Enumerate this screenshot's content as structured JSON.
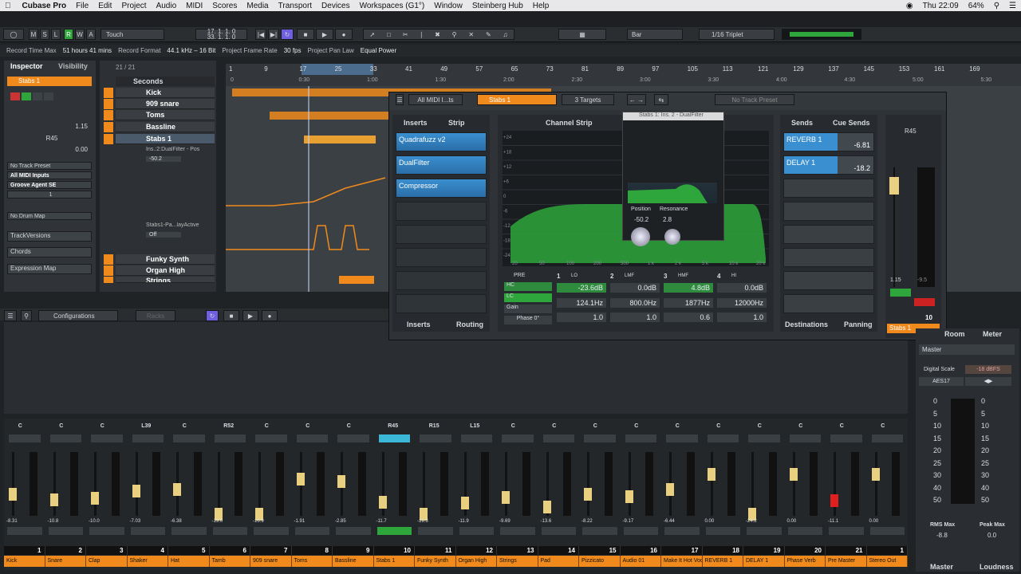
{
  "menubar": {
    "apple": "",
    "app": "Cubase Pro",
    "items": [
      "File",
      "Edit",
      "Project",
      "Audio",
      "MIDI",
      "Scores",
      "Media",
      "Transport",
      "Devices",
      "Workspaces (G1°)",
      "Window",
      "Steinberg Hub",
      "Help"
    ],
    "clock": "Thu 22:09",
    "battery": "64%"
  },
  "toolbar": {
    "mode": "Touch",
    "position_top": "17. 1. 1. 0",
    "position_bottom": "33. 1. 1. 0",
    "snap": "Bar",
    "quantize": "1/16 Triplet"
  },
  "infoline": {
    "rtm_label": "Record Time Max",
    "rtm_value": "51 hours 41 mins",
    "rf_label": "Record Format",
    "rf_value": "44.1 kHz – 16 Bit",
    "pfr_label": "Project Frame Rate",
    "pfr_value": "30 fps",
    "ppl_label": "Project Pan Law",
    "ppl_value": "Equal Power"
  },
  "inspector": {
    "tab_inspector": "Inspector",
    "tab_visibility": "Visibility",
    "track_name": "Stabs 1",
    "volume": "1.15",
    "pan": "R45",
    "offset": "0.00",
    "preset": "No Track Preset",
    "input": "All MIDI Inputs",
    "instrument": "Groove Agent SE",
    "channel": "1",
    "drum_map": "No Drum Map",
    "sections": [
      "TrackVersions",
      "Chords",
      "Expression Map"
    ]
  },
  "tracklist": {
    "counter": "21 / 21",
    "header": "Seconds",
    "tracks": [
      "Kick",
      "909 snare",
      "Toms",
      "Bassline",
      "Stabs 1",
      "Funky Synth",
      "Organ High",
      "Strings"
    ],
    "automation_track": "Ins.:2:DualFilter - Pos",
    "automation_value": "-50.2",
    "automation_track2": "Stabs1-Pa...layActive",
    "automation_value2": "Off"
  },
  "ruler": {
    "bars": [
      "1",
      "9",
      "17",
      "25",
      "33",
      "41",
      "49",
      "57",
      "65",
      "73",
      "81",
      "89",
      "97",
      "105",
      "113",
      "121",
      "129",
      "137",
      "145",
      "153",
      "161",
      "169"
    ],
    "times": [
      "0",
      "0:30",
      "1:00",
      "1:30",
      "2:00",
      "2:30",
      "3:00",
      "3:30",
      "4:00",
      "4:30",
      "5:00",
      "5:30"
    ]
  },
  "chwin": {
    "midi_input": "All MIDI I...ts",
    "channel": "Stabs 1",
    "targets": "3 Targets",
    "preset": "No Track Preset",
    "tab_inserts": "Inserts",
    "tab_strip": "Strip",
    "tab_channel_strip": "Channel Strip",
    "tab_sends": "Sends",
    "tab_cue_sends": "Cue Sends",
    "inserts": [
      "Quadrafuzz v2",
      "DualFilter",
      "Compressor"
    ],
    "sends": [
      {
        "name": "REVERB 1",
        "value": "-6.81"
      },
      {
        "name": "DELAY 1",
        "value": "-18.2"
      }
    ],
    "bottom_inserts": "Inserts",
    "bottom_routing": "Routing",
    "bottom_destinations": "Destinations",
    "bottom_panning": "Panning",
    "plugin_title": "Stabs 1: Ins. 2 - DualFilter",
    "plugin_pos_label": "Position",
    "plugin_res_label": "Resonance",
    "plugin_pos": "-50.2",
    "plugin_res": "2.8",
    "eq_x_ticks": [
      "20",
      "50",
      "100",
      "200",
      "500",
      "1 k",
      "2 k",
      "5 k",
      "10 k",
      "20 k"
    ],
    "eq_y_ticks": [
      "+24",
      "+18",
      "+12",
      "+6",
      "0",
      "-6",
      "-12",
      "-18",
      "-24"
    ],
    "pre_label": "PRE",
    "hc_label": "HC",
    "lc_label": "LC",
    "gain_label": "Gain",
    "phase_label": "Phase 0°",
    "bands": [
      {
        "n": "1",
        "type": "LO",
        "gain": "-23.6dB",
        "freq": "124.1Hz",
        "q": "1.0"
      },
      {
        "n": "2",
        "type": "LMF",
        "gain": "0.0dB",
        "freq": "800.0Hz",
        "q": "1.0"
      },
      {
        "n": "3",
        "type": "HMF",
        "gain": "4.8dB",
        "freq": "1877Hz",
        "q": "0.6"
      },
      {
        "n": "4",
        "type": "HI",
        "gain": "0.0dB",
        "freq": "12000Hz",
        "q": "1.0"
      }
    ],
    "meter_pan": "R45",
    "meter_vol": "1.15",
    "meter_peak": "-9.5",
    "channel_num": "10",
    "channel_name": "Stabs 1"
  },
  "mixbar": {
    "configurations": "Configurations",
    "racks": "Racks"
  },
  "mixer": {
    "pans": [
      "C",
      "C",
      "C",
      "L39",
      "C",
      "R52",
      "C",
      "C",
      "C",
      "R45",
      "R15",
      "L15",
      "C",
      "C",
      "C",
      "C",
      "C",
      "C",
      "C",
      "C",
      "C",
      "C"
    ],
    "values": [
      "-8.31",
      "-10.8",
      "-10.0",
      "-7.03",
      "-6.38",
      "-19.0",
      "-16.9",
      "-1.91",
      "-2.85",
      "-11.7",
      "-19.3",
      "-11.9",
      "-9.69",
      "-13.6",
      "-8.22",
      "-9.17",
      "-6.44",
      "0.00",
      "-24.2",
      "0.00",
      "-11.1",
      "0.00"
    ],
    "numbers": [
      "1",
      "2",
      "3",
      "4",
      "5",
      "6",
      "7",
      "8",
      "9",
      "10",
      "11",
      "12",
      "13",
      "14",
      "15",
      "16",
      "17",
      "18",
      "19",
      "20",
      "21",
      "1"
    ],
    "names": [
      "Kick",
      "Snare",
      "Clap",
      "Shaker",
      "Hat",
      "Tamb",
      "909 snare",
      "Toms",
      "Bassline",
      "Stabs 1",
      "Funky Synth",
      "Organ High",
      "Strings",
      "Pad",
      "Pizzicato",
      "Audio 01",
      "Make It Hot Vocal",
      "REVERB 1",
      "DELAY 1",
      "Phase Verb",
      "Pre Master",
      "Stereo Out"
    ]
  },
  "rpanel": {
    "tab_room": "Room",
    "tab_meter": "Meter",
    "master": "Master",
    "digital_scale": "Digital Scale",
    "dbfs": "-18 dBFS",
    "aes": "AES17",
    "scale": [
      "0",
      "5",
      "10",
      "15",
      "20",
      "25",
      "30",
      "40",
      "50"
    ],
    "rms_label": "RMS Max",
    "rms_value": "-8.8",
    "peak_label": "Peak Max",
    "peak_value": "0.0",
    "tab_master": "Master",
    "tab_loudness": "Loudness"
  },
  "colors": {
    "accent": "#f08a1c",
    "insert_blue": "#3a8fd0",
    "eq_green": "#2ea63c",
    "bg": "#202326"
  }
}
